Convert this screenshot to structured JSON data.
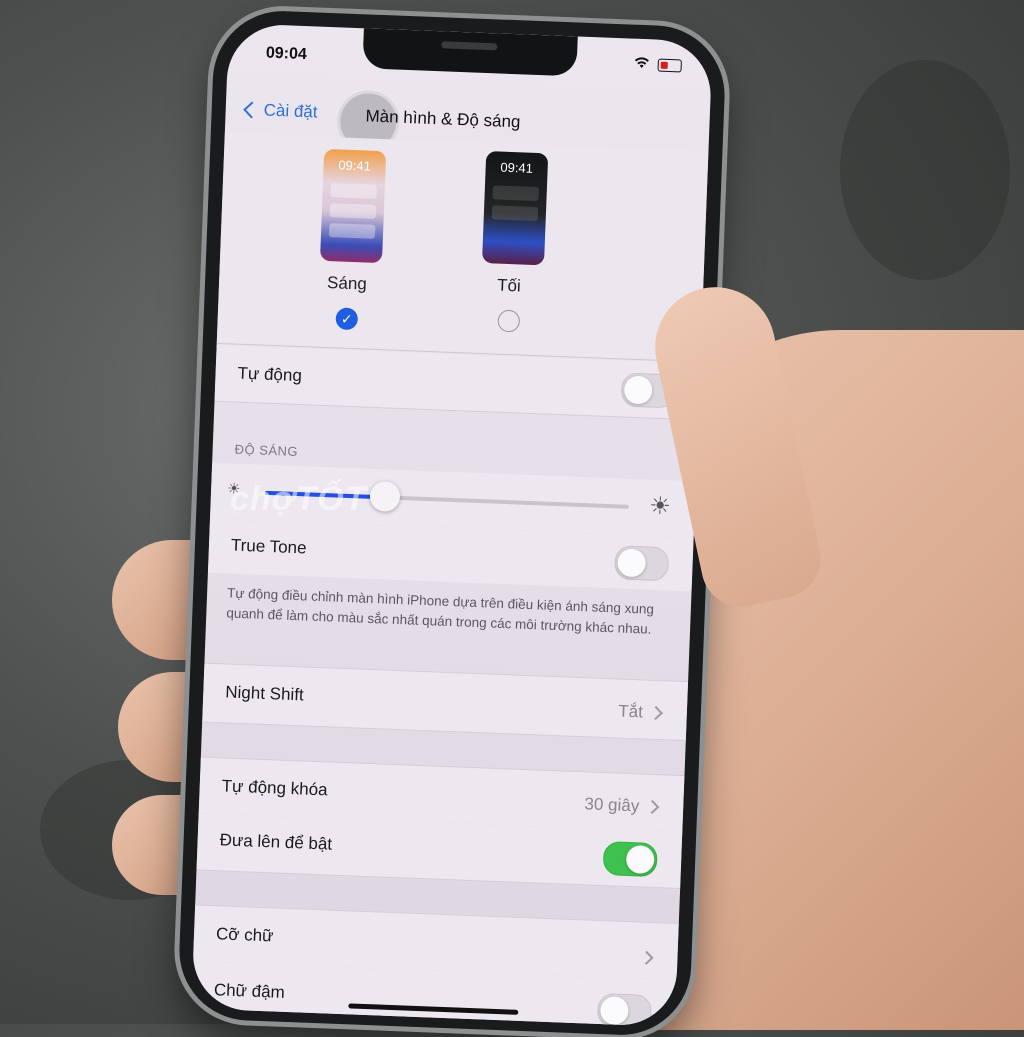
{
  "status_bar": {
    "time": "09:04",
    "wifi_icon": "wifi-icon",
    "battery_icon": "battery-low-icon"
  },
  "nav": {
    "back_label": "Cài đặt",
    "title": "Màn hình & Độ sáng"
  },
  "appearance": {
    "light": {
      "preview_time": "09:41",
      "label": "Sáng",
      "selected": true
    },
    "dark": {
      "preview_time": "09:41",
      "label": "Tối",
      "selected": false
    }
  },
  "automatic": {
    "label": "Tự động",
    "on": false
  },
  "brightness": {
    "section_header": "ĐỘ SÁNG",
    "level_fraction": 0.33
  },
  "true_tone": {
    "label": "True Tone",
    "on": false,
    "footnote": "Tự động điều chỉnh màn hình iPhone dựa trên điều kiện ánh sáng xung quanh để làm cho màu sắc nhất quán trong các môi trường khác nhau."
  },
  "night_shift": {
    "label": "Night Shift",
    "value": "Tắt"
  },
  "auto_lock": {
    "label": "Tự động khóa",
    "value": "30 giây"
  },
  "raise_to_wake": {
    "label": "Đưa lên để bật",
    "on": true
  },
  "text_size": {
    "label": "Cỡ chữ"
  },
  "bold_text": {
    "label": "Chữ đậm",
    "on": false
  },
  "watermark": {
    "text": "chợTỐT"
  },
  "colors": {
    "accent": "#2f6fd9",
    "toggle_on": "#3fc150",
    "check": "#1f5ee0"
  }
}
